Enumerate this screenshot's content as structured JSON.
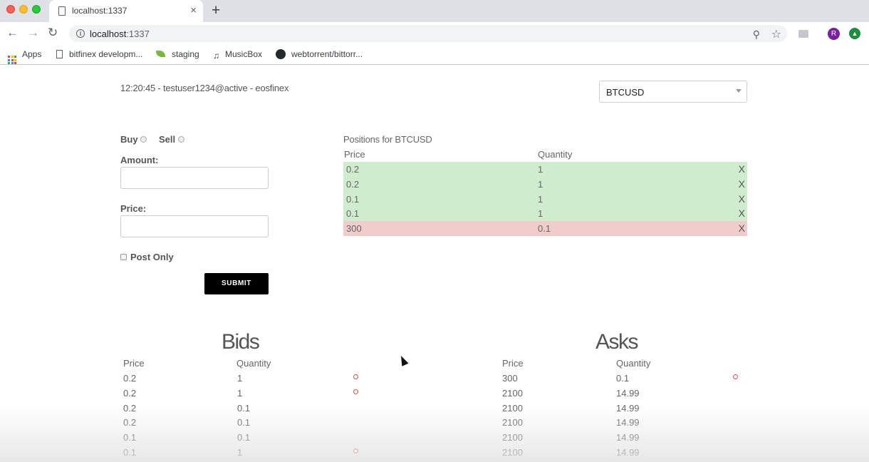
{
  "browser": {
    "tab_title": "localhost:1337",
    "new_tab_label": "+",
    "tab_close_label": "×",
    "url_host": "localhost",
    "url_port": ":1337",
    "profile_initial": "R",
    "bookmarks": [
      {
        "label": "Apps",
        "icon": "apps-grid-icon"
      },
      {
        "label": "bitfinex developm...",
        "icon": "page-icon"
      },
      {
        "label": "staging",
        "icon": "leaf-icon"
      },
      {
        "label": "MusicBox",
        "icon": "music-note-icon"
      },
      {
        "label": "webtorrent/bittorr...",
        "icon": "github-icon"
      }
    ]
  },
  "header": {
    "status": "12:20:45 - testuser1234@active - eosfinex",
    "pair_selected": "BTCUSD"
  },
  "order_form": {
    "buy_label": "Buy",
    "sell_label": "Sell",
    "amount_label": "Amount:",
    "amount_value": "",
    "price_label": "Price:",
    "price_value": "",
    "post_only_label": "Post Only",
    "submit_label": "SUBMIT"
  },
  "positions": {
    "title": "Positions for BTCUSD",
    "price_header": "Price",
    "quantity_header": "Quantity",
    "close_label": "X",
    "rows": [
      {
        "price": "0.2",
        "quantity": "1",
        "side": "long"
      },
      {
        "price": "0.2",
        "quantity": "1",
        "side": "long"
      },
      {
        "price": "0.1",
        "quantity": "1",
        "side": "long"
      },
      {
        "price": "0.1",
        "quantity": "1",
        "side": "long"
      },
      {
        "price": "300",
        "quantity": "0.1",
        "side": "short"
      }
    ]
  },
  "bids": {
    "title": "Bids",
    "price_header": "Price",
    "quantity_header": "Quantity",
    "rows": [
      {
        "price": "0.2",
        "quantity": "1",
        "own": true
      },
      {
        "price": "0.2",
        "quantity": "1",
        "own": true
      },
      {
        "price": "0.2",
        "quantity": "0.1",
        "own": false
      },
      {
        "price": "0.2",
        "quantity": "0.1",
        "own": false
      },
      {
        "price": "0.1",
        "quantity": "0.1",
        "own": false
      },
      {
        "price": "0.1",
        "quantity": "1",
        "own": true
      }
    ]
  },
  "asks": {
    "title": "Asks",
    "price_header": "Price",
    "quantity_header": "Quantity",
    "rows": [
      {
        "price": "300",
        "quantity": "0.1",
        "own": true
      },
      {
        "price": "2100",
        "quantity": "14.99",
        "own": false
      },
      {
        "price": "2100",
        "quantity": "14.99",
        "own": false
      },
      {
        "price": "2100",
        "quantity": "14.99",
        "own": false
      },
      {
        "price": "2100",
        "quantity": "14.99",
        "own": false
      },
      {
        "price": "2100",
        "quantity": "14.99",
        "own": false
      }
    ]
  },
  "colors": {
    "long_row": "#cfeccf",
    "short_row": "#f1cccc",
    "own_order_marker": "#d9534f",
    "submit_bg": "#000000"
  }
}
